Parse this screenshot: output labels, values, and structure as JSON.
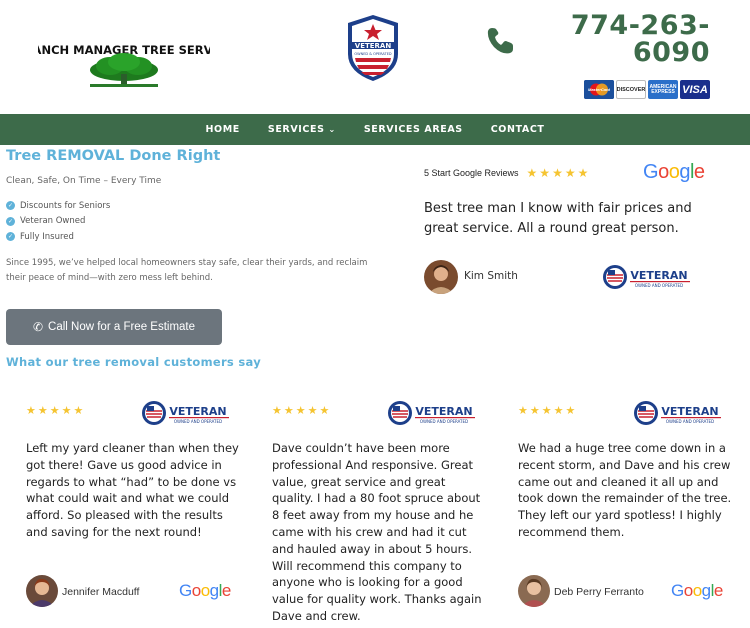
{
  "header": {
    "logo_text": "BRANCH MANAGER TREE SERVICE",
    "badge_text_line1": "VETERAN",
    "badge_text_line2": "OWNED & OPERATED",
    "phone": "774-263-6090",
    "payment_cards": [
      "MasterCard",
      "DISCOVER",
      "AMERICAN EXPRESS",
      "VISA"
    ]
  },
  "nav": {
    "items": [
      {
        "label": "HOME"
      },
      {
        "label": "SERVICES",
        "has_caret": true
      },
      {
        "label": "SERVICES AREAS"
      },
      {
        "label": "CONTACT"
      }
    ]
  },
  "hero": {
    "title": "Tree REMOVAL Done Right",
    "subtitle": "Clean, Safe, On Time – Every Time",
    "checklist": [
      "Discounts for Seniors",
      "Veteran Owned",
      "Fully Insured"
    ],
    "paragraph": "Since 1995, we’ve helped local homeowners stay safe, clear their yards, and reclaim their peace of mind—with zero mess left behind.",
    "cta_label": "Call Now for a Free Estimate",
    "section_heading": "What our tree removal customers say"
  },
  "featured_review": {
    "label": "5 Start Google Reviews",
    "stars": "★★★★★",
    "text": "Best tree man I know with fair prices and great service. All a round great person.",
    "name": "Kim Smith",
    "veteran_label": "VETERAN",
    "veteran_sub": "OWNED AND OPERATED"
  },
  "reviews": [
    {
      "stars": "★★★★★",
      "text": "Left my yard cleaner than when they got there! Gave us good advice in regards to what “had” to be done vs what could wait and what we could afford. So pleased with the results and saving for the next round!",
      "name": "Jennifer Macduff",
      "veteran_label": "VETERAN",
      "veteran_sub": "OWNED AND OPERATED"
    },
    {
      "stars": "★★★★★",
      "text": "Dave couldn’t have been more professional And responsive. Great value, great service and great quality. I had a 80 foot spruce about 8 feet away from my house and he came with his crew and had it cut and hauled away in about 5 hours. Will recommend this company to anyone who is looking for a good value for quality work. Thanks again Dave and crew.",
      "name": "",
      "veteran_label": "VETERAN",
      "veteran_sub": "OWNED AND OPERATED"
    },
    {
      "stars": "★★★★★",
      "text": "We had a huge tree come down in a recent storm, and Dave and his crew came out and cleaned it all up and took down the remainder of the tree. They left our yard spotless! I highly recommend them.",
      "name": "Deb Perry Ferranto",
      "veteran_label": "VETERAN",
      "veteran_sub": "OWNED AND OPERATED"
    }
  ],
  "colors": {
    "brand_green": "#3d6b4a",
    "accent_blue": "#5fb2d9",
    "star_gold": "#f5c431",
    "button_gray": "#6c757d"
  }
}
